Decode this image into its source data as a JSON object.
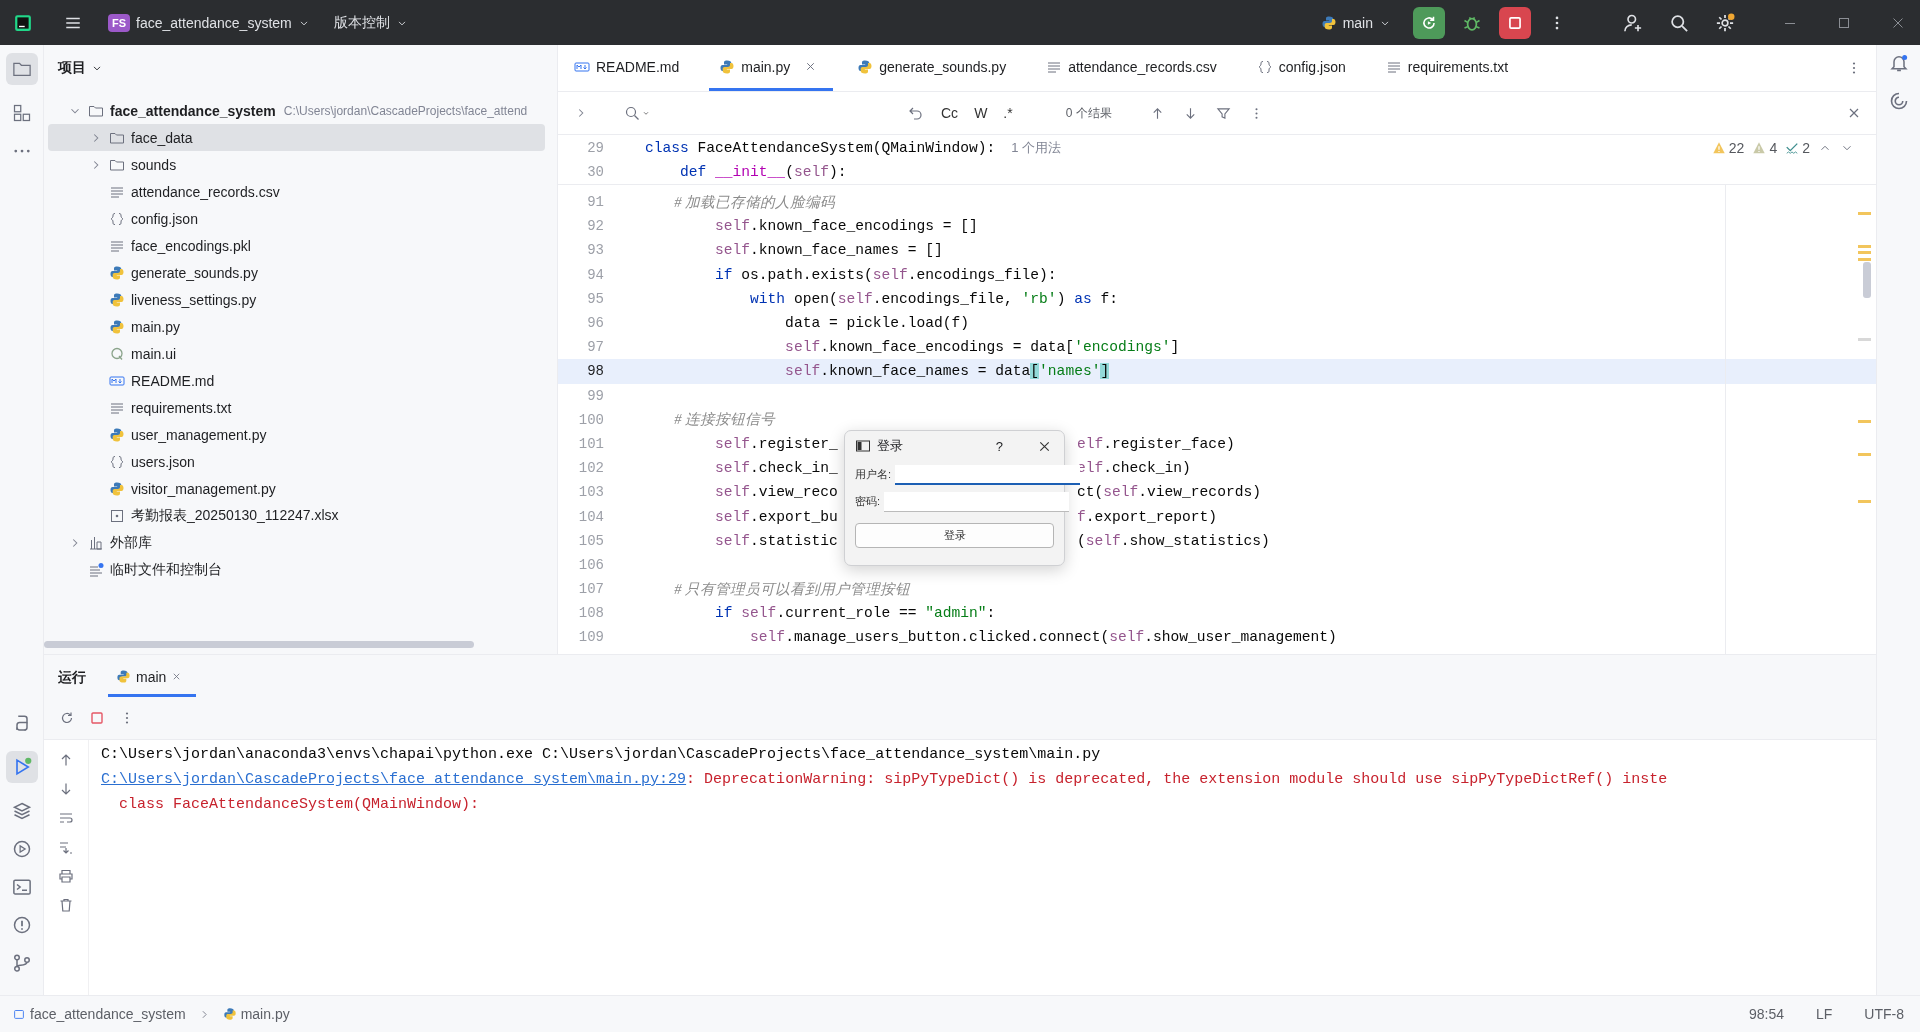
{
  "title_bar": {
    "project_badge": "FS",
    "project_name": "face_attendance_system",
    "vcs_menu": "版本控制",
    "run_config": "main"
  },
  "project_panel": {
    "title": "项目",
    "root": {
      "name": "face_attendance_system",
      "path": "C:\\Users\\jordan\\CascadeProjects\\face_attend",
      "kind": "folder",
      "expanded": true,
      "selected": false,
      "children": [
        {
          "name": "face_data",
          "kind": "folder",
          "expanded": false,
          "selected": true
        },
        {
          "name": "sounds",
          "kind": "folder",
          "expanded": false,
          "selected": false
        },
        {
          "name": "attendance_records.csv",
          "kind": "text",
          "selected": false
        },
        {
          "name": "config.json",
          "kind": "json",
          "selected": false
        },
        {
          "name": "face_encodings.pkl",
          "kind": "text",
          "selected": false
        },
        {
          "name": "generate_sounds.py",
          "kind": "python",
          "selected": false
        },
        {
          "name": "liveness_settings.py",
          "kind": "python",
          "selected": false
        },
        {
          "name": "main.py",
          "kind": "python",
          "selected": false
        },
        {
          "name": "main.ui",
          "kind": "qt",
          "selected": false
        },
        {
          "name": "README.md",
          "kind": "markdown",
          "selected": false
        },
        {
          "name": "requirements.txt",
          "kind": "text",
          "selected": false
        },
        {
          "name": "user_management.py",
          "kind": "python",
          "selected": false
        },
        {
          "name": "users.json",
          "kind": "json",
          "selected": false
        },
        {
          "name": "visitor_management.py",
          "kind": "python",
          "selected": false
        },
        {
          "name": "考勤报表_20250130_112247.xlsx",
          "kind": "unknown",
          "selected": false
        }
      ]
    },
    "extra": [
      {
        "name": "外部库",
        "kind": "library",
        "expanded": false,
        "selected": false
      },
      {
        "name": "临时文件和控制台",
        "kind": "scratch",
        "selected": false
      }
    ]
  },
  "editor": {
    "tabs": [
      {
        "label": "README.md",
        "kind": "markdown",
        "selected": false
      },
      {
        "label": "main.py",
        "kind": "python",
        "selected": true
      },
      {
        "label": "generate_sounds.py",
        "kind": "python",
        "selected": false
      },
      {
        "label": "attendance_records.csv",
        "kind": "text",
        "selected": false
      },
      {
        "label": "config.json",
        "kind": "json",
        "selected": false
      },
      {
        "label": "requirements.txt",
        "kind": "text",
        "selected": false
      }
    ],
    "find": {
      "toggles": [
        "Cc",
        "W",
        ".*"
      ],
      "result": "0 个结果"
    },
    "inspections": [
      {
        "kind": "warning",
        "count": "22"
      },
      {
        "kind": "weak",
        "count": "4"
      },
      {
        "kind": "typo",
        "count": "2"
      }
    ],
    "sticky_lines": [
      {
        "num": "29",
        "tokens": [
          {
            "text": "class",
            "kind": "kw"
          },
          {
            "text": " FaceAttendanceSystem(QMainWindow):",
            "kind": "plain"
          },
          {
            "text": "1 个用法",
            "kind": "hint"
          }
        ]
      },
      {
        "num": "30",
        "tokens": [
          {
            "text": "    def",
            "kind": "kw"
          },
          {
            "text": " __init__",
            "kind": "fn"
          },
          {
            "text": "(",
            "kind": "plain"
          },
          {
            "text": "self",
            "kind": "self"
          },
          {
            "text": "):",
            "kind": "plain"
          }
        ]
      }
    ],
    "lines": [
      {
        "num": "91",
        "current": false,
        "tokens": [
          {
            "text": "        # 加载已存储的人脸编码",
            "kind": "cm"
          }
        ]
      },
      {
        "num": "92",
        "current": false,
        "tokens": [
          {
            "text": "        self",
            "kind": "self"
          },
          {
            "text": ".known_face_encodings = []",
            "kind": "plain"
          }
        ]
      },
      {
        "num": "93",
        "current": false,
        "tokens": [
          {
            "text": "        self",
            "kind": "self"
          },
          {
            "text": ".known_face_names = []",
            "kind": "plain"
          }
        ]
      },
      {
        "num": "94",
        "current": false,
        "tokens": [
          {
            "text": "        if",
            "kind": "kw"
          },
          {
            "text": " os.path.exists(",
            "kind": "plain"
          },
          {
            "text": "self",
            "kind": "self"
          },
          {
            "text": ".encodings_file):",
            "kind": "plain"
          }
        ]
      },
      {
        "num": "95",
        "current": false,
        "tokens": [
          {
            "text": "            with",
            "kind": "kw"
          },
          {
            "text": " open(",
            "kind": "plain"
          },
          {
            "text": "self",
            "kind": "self"
          },
          {
            "text": ".encodings_file, ",
            "kind": "plain"
          },
          {
            "text": "'rb'",
            "kind": "str"
          },
          {
            "text": ") ",
            "kind": "plain"
          },
          {
            "text": "as",
            "kind": "kw"
          },
          {
            "text": " f:",
            "kind": "plain"
          }
        ]
      },
      {
        "num": "96",
        "current": false,
        "tokens": [
          {
            "text": "                data = pickle.load(f)",
            "kind": "plain"
          }
        ]
      },
      {
        "num": "97",
        "current": false,
        "tokens": [
          {
            "text": "                self",
            "kind": "self"
          },
          {
            "text": ".known_face_encodings = data[",
            "kind": "plain"
          },
          {
            "text": "'encodings'",
            "kind": "str"
          },
          {
            "text": "]",
            "kind": "plain"
          }
        ]
      },
      {
        "num": "98",
        "current": true,
        "tokens": [
          {
            "text": "                self",
            "kind": "self"
          },
          {
            "text": ".known_face_names = data",
            "kind": "plain"
          },
          {
            "text": "[",
            "kind": "br"
          },
          {
            "text": "'names'",
            "kind": "str"
          },
          {
            "text": "]",
            "kind": "br"
          }
        ]
      },
      {
        "num": "99",
        "current": false
      },
      {
        "num": "100",
        "current": false,
        "tokens": [
          {
            "text": "        # 连接按钮信号",
            "kind": "cm"
          }
        ]
      },
      {
        "num": "101",
        "current": false,
        "tokens": [
          {
            "text": "        self",
            "kind": "self"
          },
          {
            "text": ".register_",
            "kind": "plain"
          }
        ],
        "after": [
          {
            "text": "elf",
            "kind": "self"
          },
          {
            "text": ".register_face)",
            "kind": "plain"
          }
        ]
      },
      {
        "num": "102",
        "current": false,
        "tokens": [
          {
            "text": "        self",
            "kind": "self"
          },
          {
            "text": ".check_in_",
            "kind": "plain"
          }
        ],
        "after": [
          {
            "text": "elf",
            "kind": "self"
          },
          {
            "text": ".check_in)",
            "kind": "plain"
          }
        ]
      },
      {
        "num": "103",
        "current": false,
        "tokens": [
          {
            "text": "        self",
            "kind": "self"
          },
          {
            "text": ".view_reco",
            "kind": "plain"
          }
        ],
        "after": [
          {
            "text": "ct(",
            "kind": "plain"
          },
          {
            "text": "self",
            "kind": "self"
          },
          {
            "text": ".view_records)",
            "kind": "plain"
          }
        ]
      },
      {
        "num": "104",
        "current": false,
        "tokens": [
          {
            "text": "        self",
            "kind": "self"
          },
          {
            "text": ".export_bu",
            "kind": "plain"
          }
        ],
        "after": [
          {
            "text": "f",
            "kind": "self"
          },
          {
            "text": ".export_report)",
            "kind": "plain"
          }
        ]
      },
      {
        "num": "105",
        "current": false,
        "tokens": [
          {
            "text": "        self",
            "kind": "self"
          },
          {
            "text": ".statistic",
            "kind": "plain"
          }
        ],
        "after": [
          {
            "text": "(",
            "kind": "plain"
          },
          {
            "text": "self",
            "kind": "self"
          },
          {
            "text": ".show_statistics)",
            "kind": "plain"
          }
        ]
      },
      {
        "num": "106",
        "current": false
      },
      {
        "num": "107",
        "current": false,
        "tokens": [
          {
            "text": "        # 只有管理员可以看到用户管理按钮",
            "kind": "cm"
          }
        ]
      },
      {
        "num": "108",
        "current": false,
        "tokens": [
          {
            "text": "        if",
            "kind": "kw"
          },
          {
            "text": " self",
            "kind": "self"
          },
          {
            "text": ".current_role == ",
            "kind": "plain"
          },
          {
            "text": "\"admin\"",
            "kind": "str"
          },
          {
            "text": ":",
            "kind": "plain"
          }
        ]
      },
      {
        "num": "109",
        "current": false,
        "tokens": [
          {
            "text": "            self",
            "kind": "self"
          },
          {
            "text": ".manage_users_button.clicked.connect(",
            "kind": "plain"
          },
          {
            "text": "self",
            "kind": "self"
          },
          {
            "text": ".show_user_management)",
            "kind": "plain"
          }
        ]
      }
    ]
  },
  "dialog": {
    "title": "登录",
    "help": "?",
    "fields": [
      {
        "label": "用户名:",
        "focused": true
      },
      {
        "label": "密码:",
        "focused": false
      }
    ],
    "button": "登录"
  },
  "run_panel": {
    "title": "运行",
    "tabs": [
      {
        "label": "main",
        "selected": true
      }
    ],
    "console": [
      {
        "segments": [
          {
            "text": "C:\\Users\\jordan\\anaconda3\\envs\\chapai\\python.exe C:\\Users\\jordan\\CascadeProjects\\face_attendance_system\\main.py",
            "kind": "out"
          }
        ]
      },
      {
        "segments": [
          {
            "text": "C:\\Users\\jordan\\CascadeProjects\\face_attendance_system\\main.py:29",
            "kind": "link"
          },
          {
            "text": ": DeprecationWarning: sipPyTypeDict() is deprecated, the extension module should use sipPyTypeDictRef() inste",
            "kind": "err"
          }
        ]
      },
      {
        "segments": [
          {
            "text": "  class FaceAttendanceSystem(QMainWindow):",
            "kind": "err"
          }
        ]
      }
    ]
  },
  "status_bar": {
    "breadcrumbs": [
      {
        "text": "face_attendance_system",
        "kind": "module"
      },
      {
        "text": "main.py",
        "kind": "python"
      }
    ],
    "position": "98:54",
    "line_ending": "LF",
    "encoding": "UTF-8"
  }
}
